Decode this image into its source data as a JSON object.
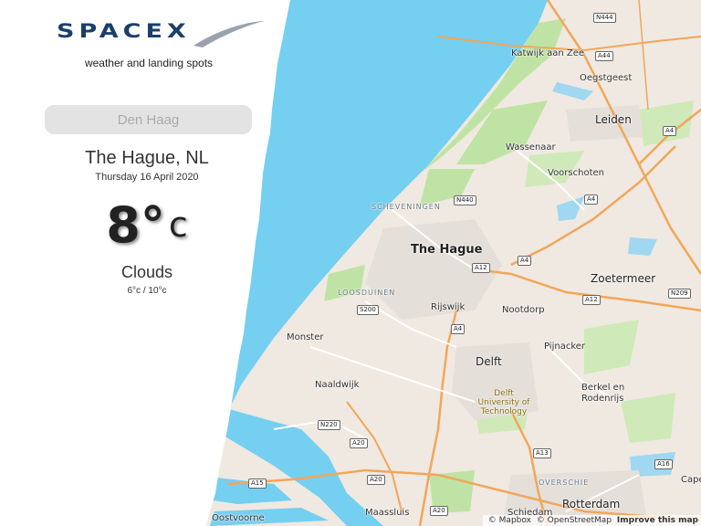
{
  "header": {
    "logo_text": "SPACEX",
    "tagline": "weather and landing spots"
  },
  "search": {
    "placeholder": "Den Haag"
  },
  "weather": {
    "city": "The Hague, NL",
    "date": "Thursday 16 April 2020",
    "temperature": "8°",
    "unit": "c",
    "condition": "Clouds",
    "range": "6°c / 10°c"
  },
  "map": {
    "labels": {
      "katwijk": "Katwijk aan Zee",
      "oegstgeest": "Oegstgeest",
      "leiden": "Leiden",
      "wassenaar": "Wassenaar",
      "voorschoten": "Voorschoten",
      "scheveningen": "SCHEVENINGEN",
      "the_hague": "The Hague",
      "zoetermeer": "Zoetermeer",
      "loosduinen": "LOOSDUINEN",
      "rijswijk": "Rijswijk",
      "nootdorp": "Nootdorp",
      "monster": "Monster",
      "pijnacker": "Pijnacker",
      "delft": "Delft",
      "tu_delft": "Delft University of Technology",
      "naaldwijk": "Naaldwijk",
      "berkel": "Berkel en Rodenrijs",
      "overschie": "OVERSCHIE",
      "maassluis": "Maassluis",
      "schiedam": "Schiedam",
      "rotterdam": "Rotterdam",
      "oostvoorne": "Oostvoorne",
      "cape": "Cape"
    },
    "shields": {
      "n444": "N444",
      "a44": "A44",
      "a4_top": "A4",
      "n440": "N440",
      "a4_mid": "A4",
      "a12_hague": "A12",
      "a4_right": "A4",
      "a12_right": "A12",
      "n209": "N209",
      "s200": "S200",
      "a4_rijswijk": "A4",
      "n220": "N220",
      "a20_a": "A20",
      "a13": "A13",
      "a15": "A15",
      "a20_b": "A20",
      "a20_c": "A20",
      "a16": "A16"
    },
    "attribution": {
      "mapbox": "© Mapbox",
      "osm": "© OpenStreetMap",
      "improve": "Improve this map"
    }
  },
  "colors": {
    "sea": "#75cff0",
    "land": "#efe9e1",
    "park": "#bfe3a4",
    "motorway": "#f2a65a",
    "brand": "#1b3f6b"
  }
}
